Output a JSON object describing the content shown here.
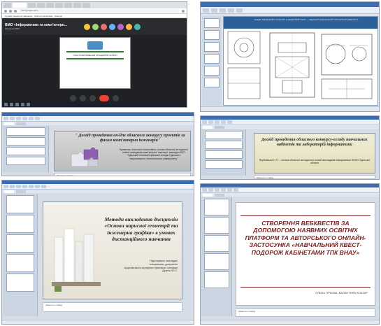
{
  "panel1": {
    "url": "meet.google.com/...",
    "bookmarks_text": "Сучасні технології навчання · Освітні платформи · Конкурс",
    "meeting_title": "ВМО «Інформатики та комп'ютерн...",
    "meeting_subtitle": "Засідання ВМО",
    "slide_text": "СТАН РОЗРОБЛЕННЯ СТАНДАРТІВ ОСВІТИ",
    "avatar_colors": [
      "#f4c542",
      "#a3d977",
      "#e57373",
      "#64b5f6",
      "#ba68c8",
      "#ffb74d",
      "#4db6ac"
    ]
  },
  "panel2": {
    "banner_text": "Секція \"Інформаційні технології в професійній освіті\" — Одеський національний політехнічний університет"
  },
  "panel3": {
    "title": "\" Досвід проведення on-line обласного конкурсу проектів за фахом комп'ютерна інженерія\"",
    "body": "Кривченко Анастасія Анатоліївна–голова обласної методичної комісії викладачів комп'ютерної інженерії, викладач ВСП \"Одеський технічний фаховий коледж Одеського національного технологічного університету\"",
    "notes": "Заметки к слайду"
  },
  "panel4": {
    "title": "Досвід проведення обласного конкурсу-огляду навчальних кабінетів та лабораторій інформатики",
    "body": "Якубовська Н.Л. – голова обласної методичної комісії викладачів інформатики ФЗПО Одеської області",
    "notes": "Заметки к слайду"
  },
  "panel5": {
    "title": "Методи викладання дисциплін «Основи нарисної геометрії та інженерна графіка» в умовах дистанційного навчання",
    "body_lines": [
      "Підготувала: викладач",
      "спеціальних дисциплін",
      "Арцизівського аграрного фахового коледжу",
      "Драгіш Ю.С."
    ],
    "notes": "Заметки к слайду"
  },
  "panel6": {
    "title": "СТВОРЕННЯ ВЕБКВЕСТІВ ЗА ДОПОМОГОЮ НАЯВНИХ ОСВІТНІХ ПЛАТФОРМ ТА АВТОРСЬКОГО ОНЛАЙН-ЗАСТОСУНКА «НАВЧАЛЬНИЙ КВЕСТ-ПОДОРОЖ КАБІНЕТАМИ ТПК ВНАУ»",
    "authors": "ОЛЕНА ГІРКОВА, ВАЛЕНТИНА КОБЗАР",
    "notes": "Заметки к слайду"
  },
  "colors": {
    "ppt_blue": "#3b6bb1",
    "quest_title": "#7a1f1f",
    "meet_dark": "#202124"
  }
}
